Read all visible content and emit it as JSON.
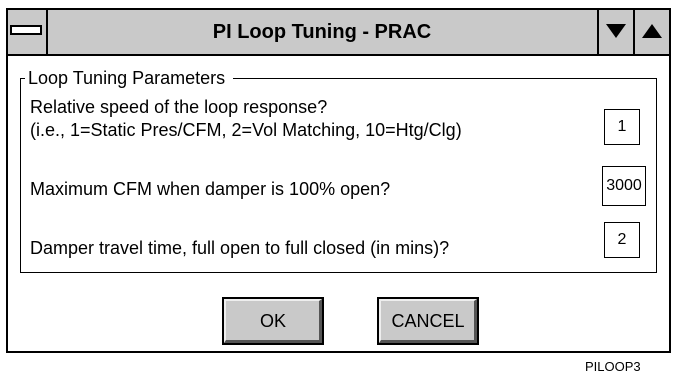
{
  "window": {
    "title": "PI Loop Tuning - PRAC",
    "system_menu_icon": "window-bar-icon",
    "minimize_icon": "triangle-down-icon",
    "maximize_icon": "triangle-up-icon"
  },
  "group": {
    "legend": "Loop Tuning Parameters"
  },
  "params": [
    {
      "question": "Relative speed of the loop response?",
      "hint": "(i.e., 1=Static Pres/CFM, 2=Vol Matching, 10=Htg/Clg)",
      "value": "1"
    },
    {
      "question": "Maximum CFM when damper is 100% open?",
      "value": "3000"
    },
    {
      "question": "Damper travel time, full open to full closed (in mins)?",
      "value": "2"
    }
  ],
  "buttons": {
    "ok": "OK",
    "cancel": "CANCEL"
  },
  "figure_label": "PILOOP3",
  "colors": {
    "titlebar": "#c9c9c9",
    "button": "#c9c9c9",
    "border": "#000000",
    "background": "#ffffff"
  }
}
